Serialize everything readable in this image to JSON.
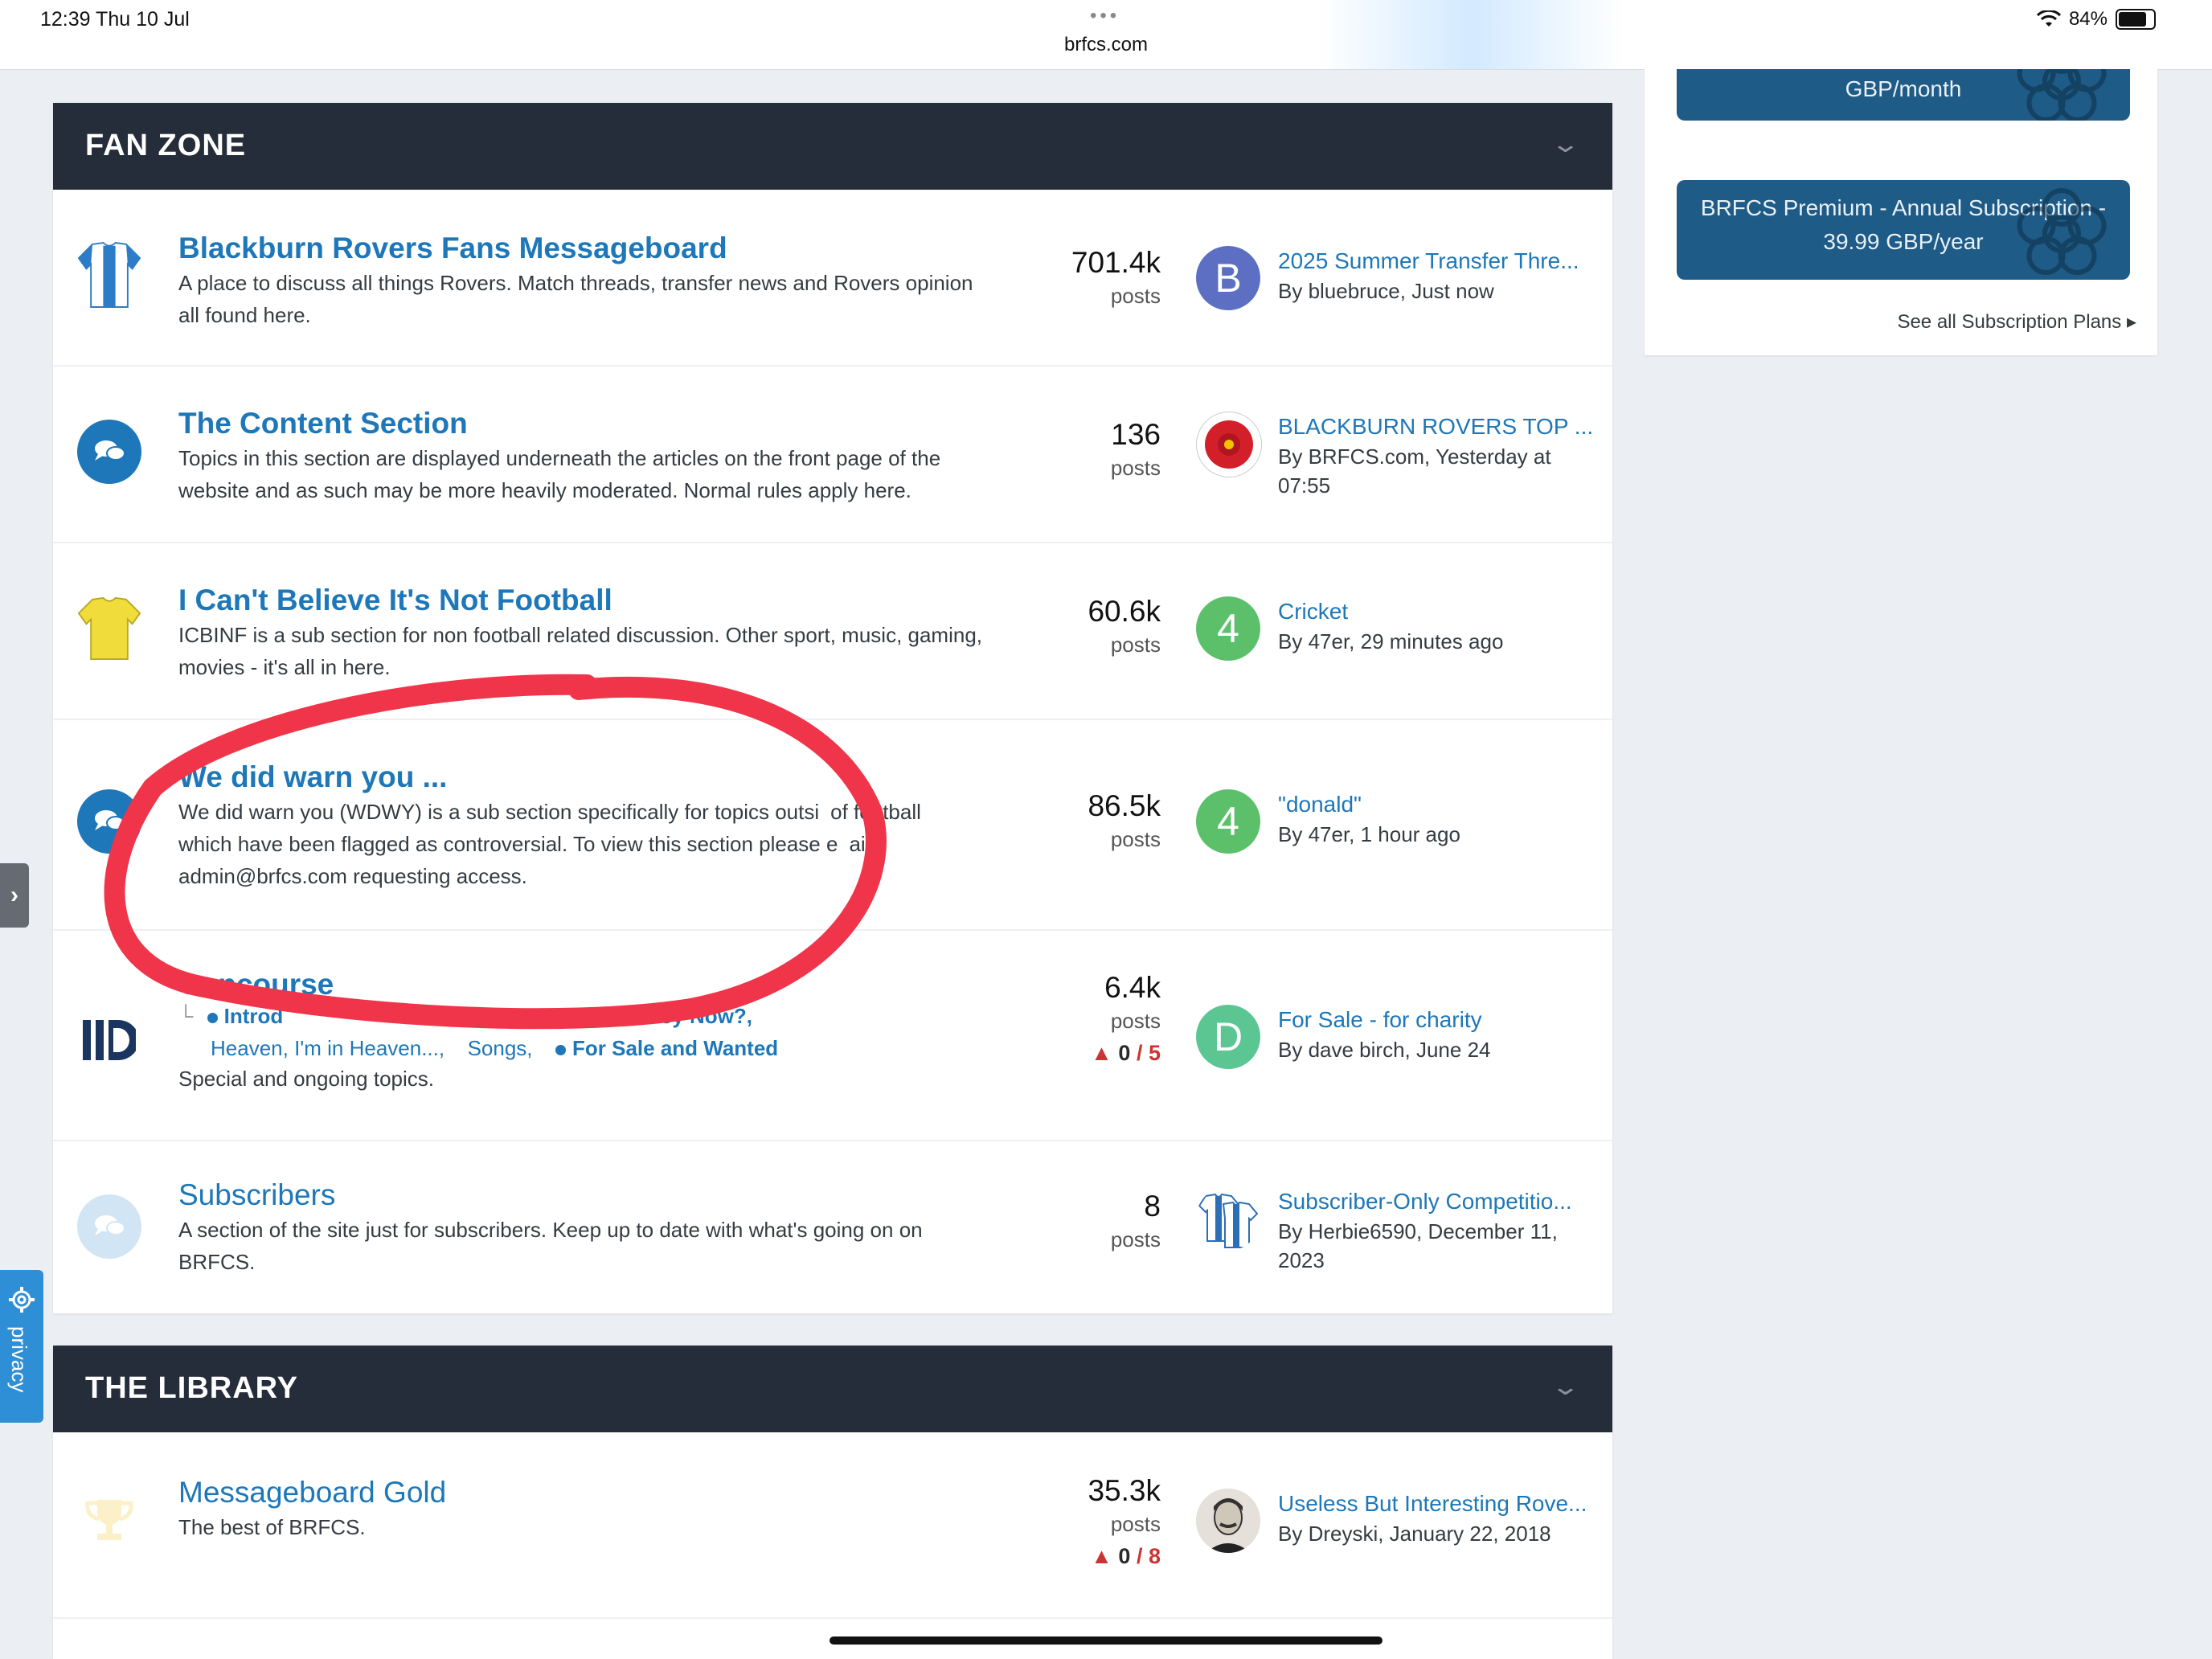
{
  "status_bar": {
    "time": "12:39  Thu 10 Jul",
    "url": "brfcs.com",
    "menu_dots": "•••",
    "battery": "84%"
  },
  "sidebar": {
    "plan_monthly": "GBP/month",
    "plan_annual_line1": "BRFCS Premium - Annual Subscription -",
    "plan_annual_line2": "39.99 GBP/year",
    "see_all": "See all Subscription Plans ▸"
  },
  "categories": [
    {
      "title": "FAN ZONE",
      "forums": [
        {
          "name": "Blackburn Rovers Fans Messageboard",
          "desc": "A place to discuss all things Rovers. Match threads, transfer news and Rovers opinion all found here.",
          "count": "701.4k",
          "count_label": "posts",
          "avatar_letter": "B",
          "avatar_color": "#5c6fc2",
          "last_title": "2025 Summer Transfer Thre...",
          "last_meta": "By bluebruce, Just now"
        },
        {
          "name": "The Content Section",
          "desc": "Topics in this section are displayed underneath the articles on the front page of the website and as such may be more heavily moderated. Normal rules apply here.",
          "count": "136",
          "count_label": "posts",
          "last_title": "BLACKBURN ROVERS TOP ...",
          "last_meta": "By BRFCS.com, Yesterday at 07:55"
        },
        {
          "name": "I Can't Believe It's Not Football",
          "desc": "ICBINF is a sub section for non football related discussion. Other sport, music, gaming, movies - it's all in here.",
          "count": "60.6k",
          "count_label": "posts",
          "avatar_letter": "4",
          "avatar_color": "#5cc06a",
          "last_title": "Cricket",
          "last_meta": "By 47er, 29 minutes ago"
        },
        {
          "name": "We did warn you ...",
          "desc_line1": "We did warn you (WDWY) is a sub section specifically for topics outsi",
          "desc_line1_end": "of football",
          "desc_line2": "which have been flagged as controversial. To view this section please e",
          "desc_line2_end": "ail",
          "desc_line3": "admin@brfcs.com requesting access.",
          "count": "86.5k",
          "count_label": "posts",
          "avatar_letter": "4",
          "avatar_color": "#5cc06a",
          "last_title": "\"donald\"",
          "last_meta": "By 47er, 1 hour ago"
        },
        {
          "name": "Concourse",
          "sub1": "Introd",
          "sub2": "Are They Now?,",
          "sub3": "Heaven, I'm in Heaven...,",
          "sub4": "Songs,",
          "sub5": "For Sale and Wanted",
          "desc": "Special and ongoing topics.",
          "count": "6.4k",
          "count_label": "posts",
          "warn_a": "0",
          "warn_sep": "/",
          "warn_b": "5",
          "avatar_letter": "D",
          "avatar_color": "#5cc693",
          "last_title": "For Sale - for charity",
          "last_meta": "By dave birch, June 24"
        },
        {
          "name": "Subscribers",
          "desc": "A section of the site just for subscribers. Keep up to date with what's going on on BRFCS.",
          "count": "8",
          "count_label": "posts",
          "last_title": "Subscriber-Only Competitio...",
          "last_meta": "By Herbie6590, December 11, 2023"
        }
      ]
    },
    {
      "title": "THE LIBRARY",
      "forums": [
        {
          "name": "Messageboard Gold",
          "desc": "The best of BRFCS.",
          "count": "35.3k",
          "count_label": "posts",
          "warn_a": "0",
          "warn_sep": "/",
          "warn_b": "8",
          "last_title": "Useless But Interesting Rove...",
          "last_meta": "By Dreyski, January 22, 2018"
        }
      ]
    }
  ],
  "privacy_tab": "privacy",
  "edge_tab": "›",
  "colors": {
    "header": "#262d3a",
    "link": "#1d77b8",
    "annotation": "#f0354a",
    "subscription": "#1e5b86"
  }
}
